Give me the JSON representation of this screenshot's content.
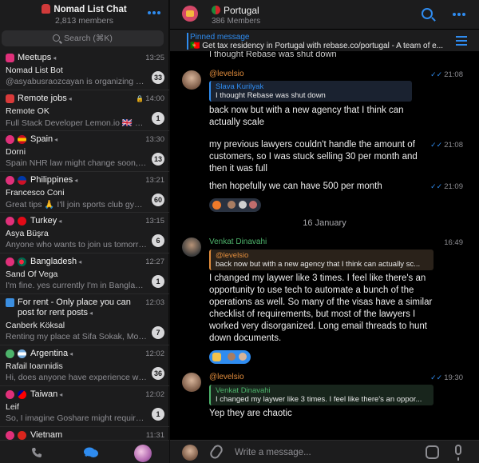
{
  "sidebar": {
    "title": "Nomad List Chat",
    "members": "2,813 members",
    "search_placeholder": "Search (⌘K)",
    "chats": [
      {
        "name": "Meetups",
        "time": "13:25",
        "sender": "Nomad List Bot",
        "preview": "@asyabusraozcayan is organizing a m...",
        "badge": "33"
      },
      {
        "name": "Remote jobs",
        "time": "14:00",
        "sender": "Remote OK",
        "preview": "Full Stack Developer Lemon.io 🇬🇧 Unit...",
        "badge": "1"
      },
      {
        "name": "Spain",
        "time": "13:30",
        "sender": "Dorni",
        "preview": "Spain NHR law might change soon, it...",
        "badge": "13"
      },
      {
        "name": "Philippines",
        "time": "13:21",
        "sender": "Francesco Coni",
        "preview": "Great tips 🙏 I'll join sports club gyms...",
        "badge": "60"
      },
      {
        "name": "Turkey",
        "time": "13:15",
        "sender": "Asya Büşra",
        "preview": "Anyone who wants to join us tomorrow...",
        "badge": "6"
      },
      {
        "name": "Bangladesh",
        "time": "12:27",
        "sender": "Sand Of Vega",
        "preview": "I'm fine. yes currently I'm in Banglades...",
        "badge": "1"
      },
      {
        "name": "For rent - Only place you can",
        "name2": "post for rent posts",
        "time": "12:03",
        "sender": "Canberk Köksal",
        "preview": "Renting my place at Sifa Sokak, Moda...",
        "badge": "7"
      },
      {
        "name": "Argentina",
        "time": "12:02",
        "sender": "Rafail Ioannidis",
        "preview": "Hi, does anyone have experience with...",
        "badge": "36"
      },
      {
        "name": "Taiwan",
        "time": "12:02",
        "sender": "Leif",
        "preview": "So, I imagine Goshare might require th...",
        "badge": "1"
      },
      {
        "name": "Vietnam",
        "time": "11:31"
      }
    ]
  },
  "chat": {
    "title": "Portugal",
    "members": "386 Members",
    "pinned_label": "Pinned message",
    "pinned_text": "🇵🇹 Get tax residency in Portugal with rebase.co/portugal - A team of e...",
    "cut_text": "I thought Rebase was shut down",
    "messages": [
      {
        "sender": "@levelsio",
        "time": "21:08",
        "reply_name": "Slava Kurilyak",
        "reply_text": "I thought Rebase was shut down",
        "text": "back now but with a new agency that I think can actually scale"
      },
      {
        "time": "21:08",
        "text": "my previous lawyers couldn't handle the amount of customers, so I was stuck selling 30 per month and then it was full"
      },
      {
        "time": "21:09",
        "text": "then hopefully we can have 500 per month"
      },
      {
        "sender": "Venkat Dinavahi",
        "time": "16:49",
        "reply_name": "@levelsio",
        "reply_text": "back now but with a new agency that I think can actually sc...",
        "text": "I changed my laywer like 3 times. I feel like there's an opportunity to use tech to automate a bunch of the operations as well. So many of the visas have a similar checklist of requirements, but most of the lawyers I worked very disorganized. Long email threads to hunt down documents."
      },
      {
        "sender": "@levelsio",
        "time": "19:30",
        "reply_name": "Venkat Dinavahi",
        "reply_text": "I changed my laywer like 3 times. I feel like there's an oppor...",
        "text": "Yep they are chaotic"
      }
    ],
    "date_separator": "16 January",
    "composer_placeholder": "Write a message..."
  },
  "colors": {
    "accent": "#2f8cf0",
    "orange_name": "#e28d3c",
    "green_name": "#4db36b"
  }
}
